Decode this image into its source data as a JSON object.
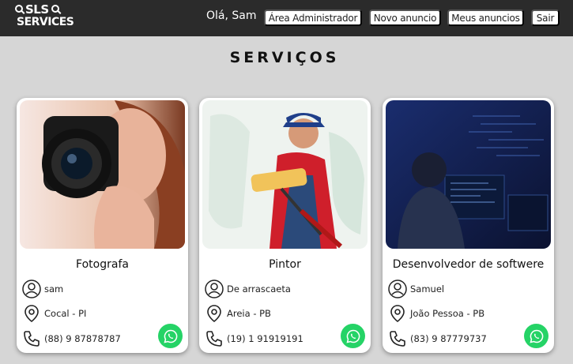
{
  "header": {
    "logo_text_line1": "SLS",
    "logo_text_line2": "SERVICES",
    "greeting": "Olá, Sam",
    "nav": {
      "admin_label": "Área Administrador",
      "new_ad_label": "Novo anuncio",
      "my_ads_label": "Meus anuncios",
      "logout_label": "Sair"
    }
  },
  "main": {
    "title": "SERVIÇOS",
    "cards": [
      {
        "title": "Fotografa",
        "user": "sam",
        "location": "Cocal - PI",
        "phone": "(88) 9 87878787",
        "image": "photographer-photo"
      },
      {
        "title": "Pintor",
        "user": "De arrascaeta",
        "location": "Areia - PB",
        "phone": "(19) 1 91919191",
        "image": "painter-photo"
      },
      {
        "title": "Desenvolvedor de softwere",
        "user": "Samuel",
        "location": "João Pessoa - PB",
        "phone": "(83) 9 87779737",
        "image": "developer-photo"
      }
    ]
  },
  "colors": {
    "navbar": "#2b2b2b",
    "page_background": "#d6d6d6",
    "whatsapp": "#25d366"
  },
  "icons": [
    "user-icon",
    "location-pin-icon",
    "phone-icon",
    "whatsapp-icon"
  ]
}
